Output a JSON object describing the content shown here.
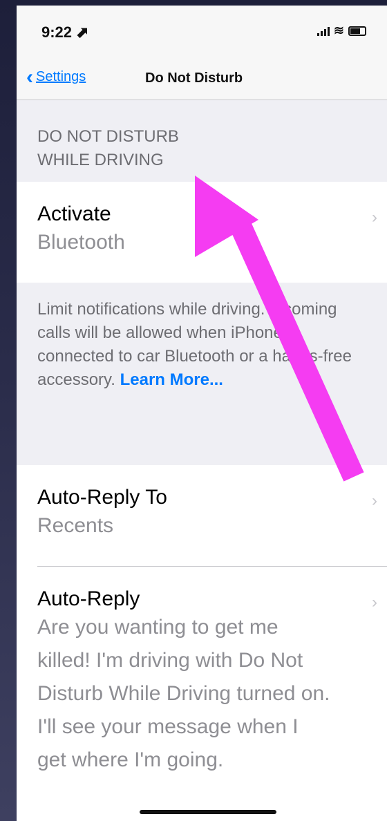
{
  "status_bar": {
    "time": "9:22 ⬈",
    "wifi_icon": "wifi-icon"
  },
  "nav": {
    "back_label": "Settings",
    "title": "Do Not Disturb"
  },
  "section": {
    "header_line1": "DO NOT DISTURB",
    "header_line2": "WHILE DRIVING"
  },
  "activate": {
    "title": "Activate",
    "value": "Bluetooth"
  },
  "footer": {
    "text": "Limit notifications while driving. Incoming calls will be allowed when iPhone is connected to car Bluetooth or a hands-free accessory.",
    "learn_more": "Learn More..."
  },
  "auto_reply_to": {
    "title": "Auto-Reply To",
    "value": "Recents"
  },
  "auto_reply": {
    "title": "Auto-Reply",
    "message": "Are you wanting to get me killed! I'm driving with Do Not Disturb While Driving turned on. I'll see your message when I get where I'm going."
  },
  "colors": {
    "accent": "#007aff",
    "annotation_arrow": "#f53cf2"
  }
}
